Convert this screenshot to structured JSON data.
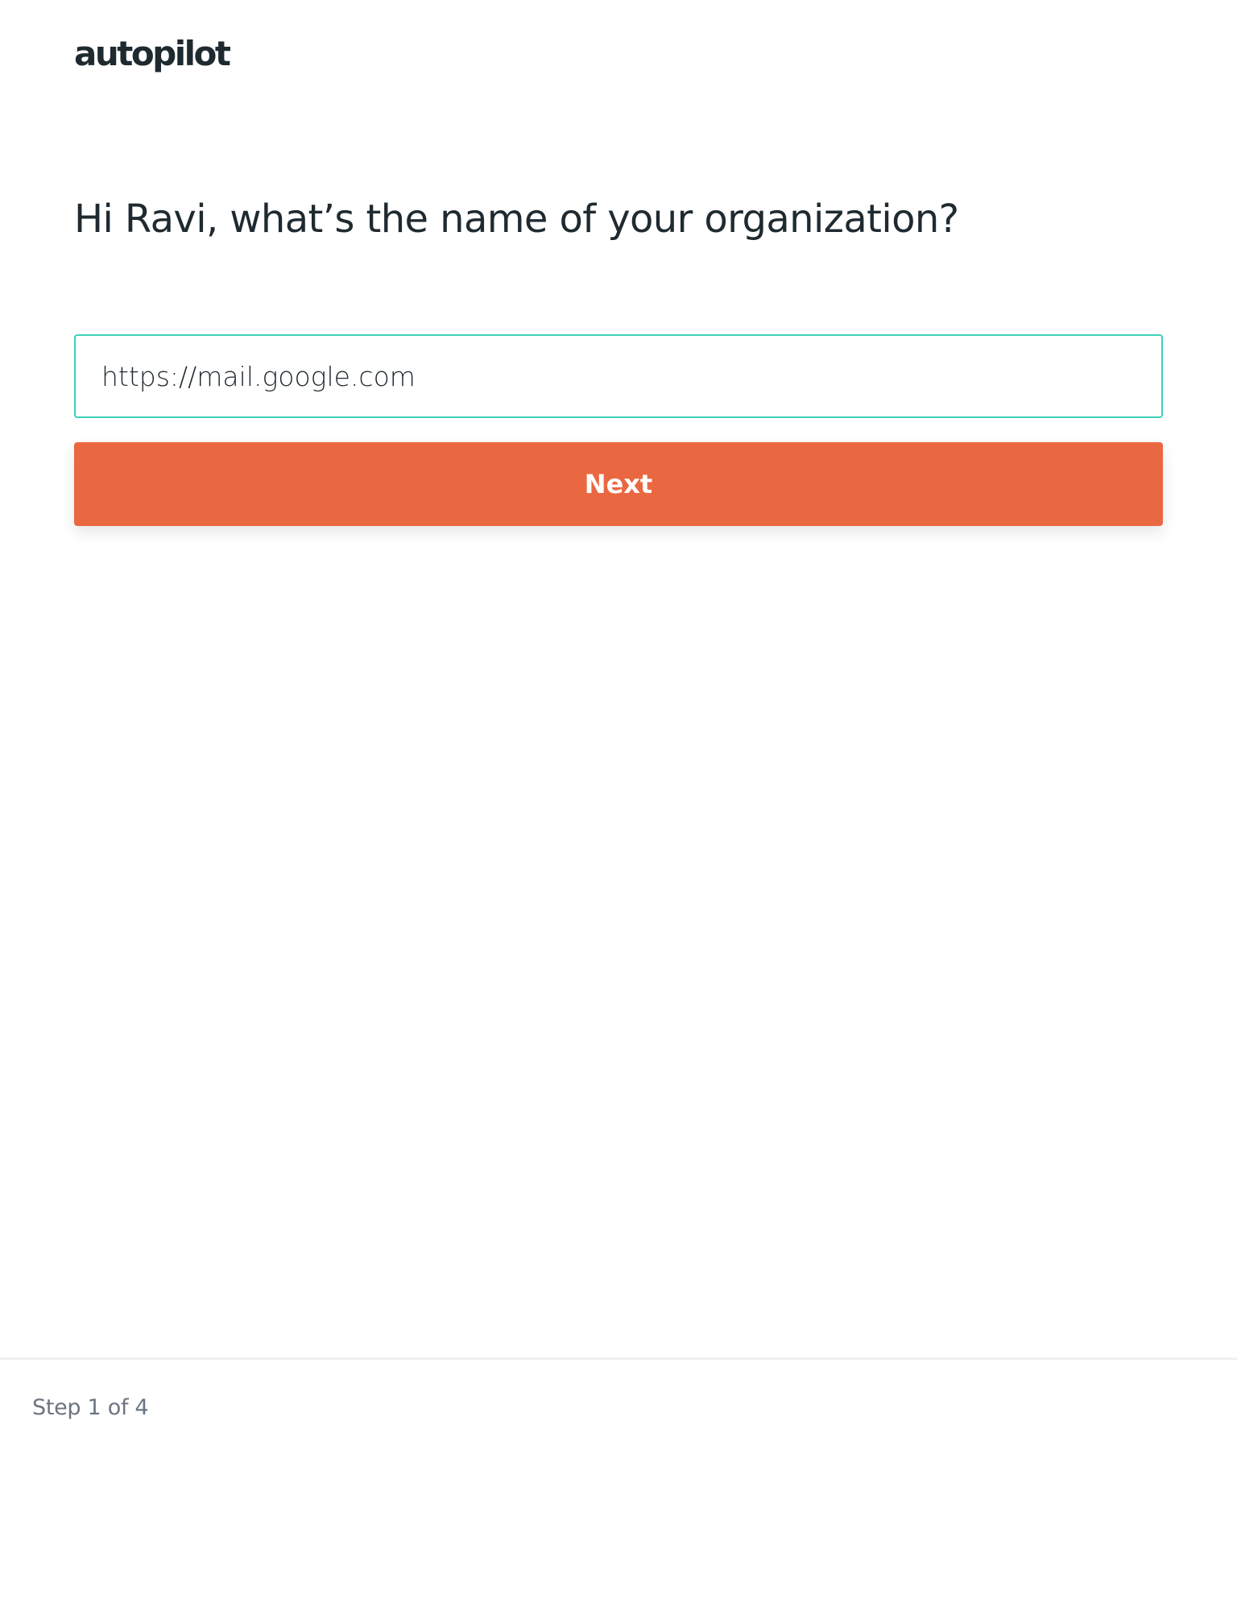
{
  "brand": {
    "logo_text": "autopilot"
  },
  "main": {
    "heading": "Hi Ravi, what’s the name of your organization?",
    "org_input": {
      "value": "https://mail.google.com",
      "placeholder": ""
    },
    "next_button_label": "Next"
  },
  "footer": {
    "step_label": "Step 1 of 4"
  },
  "colors": {
    "accent_button": "#ea6841",
    "input_focus_border": "#3dd1b8",
    "text_primary": "#1f2a30",
    "text_muted": "#6b7580"
  }
}
